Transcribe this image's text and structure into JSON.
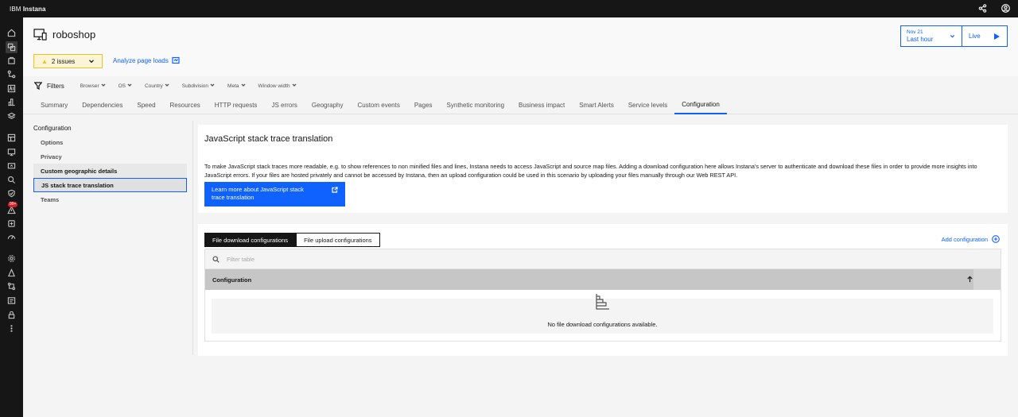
{
  "topbar": {
    "brand_prefix": "IBM ",
    "brand_name": "Instana"
  },
  "nav": {
    "alerts_badge": "99+"
  },
  "header": {
    "app_name": "roboshop",
    "issues_label": "2 issues",
    "analyze_label": "Analyze page loads",
    "time": {
      "date": "Nov 21",
      "range": "Last hour",
      "live": "Live"
    }
  },
  "filters": {
    "title": "Filters",
    "items": [
      "Browser",
      "OS",
      "Country",
      "Subdivision",
      "Meta",
      "Window width"
    ]
  },
  "tabs": [
    "Summary",
    "Dependencies",
    "Speed",
    "Resources",
    "HTTP requests",
    "JS errors",
    "Geography",
    "Custom events",
    "Pages",
    "Synthetic monitoring",
    "Business impact",
    "Smart Alerts",
    "Service levels",
    "Configuration"
  ],
  "active_tab": "Configuration",
  "side_menu": {
    "heading": "Configuration",
    "items": [
      "Options",
      "Privacy",
      "Custom geographic details",
      "JS stack trace translation",
      "Teams"
    ]
  },
  "stack_trace": {
    "title": "JavaScript stack trace translation",
    "description": "To make JavaScript stack traces more readable, e.g. to show references to non minified files and lines, Instana needs to access JavaScript and source map files. Adding a download configuration here allows Instana's server to authenticate and download these files in order to provide more insights into JavaScript errors. If your files are hosted privately and cannot be accessed by Instana, then an upload configuration could be used in this scenario by uploading your files manually through our Web REST API.",
    "learn_more": "Learn more about JavaScript stack trace translation"
  },
  "configs": {
    "tab_download": "File download configurations",
    "tab_upload": "File upload configurations",
    "add_label": "Add configuration",
    "filter_placeholder": "Filter table",
    "column": "Configuration",
    "empty_message": "No file download configurations available."
  },
  "colors": {
    "accent": "#0f62fe",
    "warning": "#f1c21b",
    "topbar": "#161616"
  }
}
